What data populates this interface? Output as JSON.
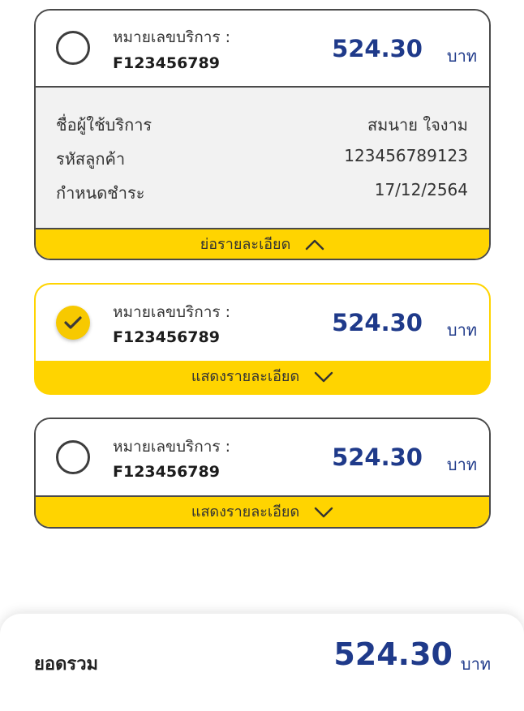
{
  "bills": [
    {
      "service_label": "หมายเลขบริการ :",
      "service_number": "F123456789",
      "amount": "524.30",
      "currency": "บาท",
      "selected": false,
      "expanded": true,
      "details": [
        {
          "label": "ชื่อผู้ใช้บริการ",
          "value": "สมนาย ใจงาม"
        },
        {
          "label": "รหัสลูกค้า",
          "value": "123456789123"
        },
        {
          "label": "กำหนดชำระ",
          "value": "17/12/2564"
        }
      ],
      "toggle_label": "ย่อรายละเอียด"
    },
    {
      "service_label": "หมายเลขบริการ :",
      "service_number": "F123456789",
      "amount": "524.30",
      "currency": "บาท",
      "selected": true,
      "expanded": false,
      "toggle_label": "แสดงรายละเอียด"
    },
    {
      "service_label": "หมายเลขบริการ :",
      "service_number": "F123456789",
      "amount": "524.30",
      "currency": "บาท",
      "selected": false,
      "expanded": false,
      "toggle_label": "แสดงรายละเอียด"
    }
  ],
  "total": {
    "label": "ยอดรวม",
    "amount": "524.30",
    "currency": "บาท"
  },
  "colors": {
    "accent_yellow": "#ffd400",
    "amount_blue": "#1f3a8a",
    "border_gray": "#4a4a4a",
    "details_bg": "#f2f2f2"
  }
}
